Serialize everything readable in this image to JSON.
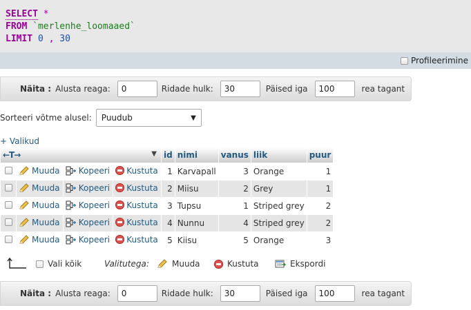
{
  "sql": {
    "select_kw": "SELECT",
    "star": "*",
    "from_kw": "FROM",
    "table": "`merlenhe_loomaaed`",
    "limit_kw": "LIMIT",
    "limit_offset": "0",
    "limit_comma": ",",
    "limit_count": "30"
  },
  "profiling": {
    "label": "Profileerimine",
    "checked": false
  },
  "nav": {
    "show_label": "Näita :",
    "start_label": "Alusta reaga:",
    "start_value": "0",
    "rows_label": "Ridade hulk:",
    "rows_value": "30",
    "headers_label": "Päised iga",
    "headers_value": "100",
    "headers_suffix": "rea tagant"
  },
  "sort": {
    "label": "Sorteeri võtme alusel:",
    "selected": "Puudub"
  },
  "options_link": "+ Valikud",
  "table": {
    "columns": [
      "id",
      "nimi",
      "vanus",
      "liik",
      "puur"
    ],
    "row_actions": {
      "edit": "Muuda",
      "copy": "Kopeeri",
      "delete": "Kustuta"
    },
    "rows": [
      {
        "id": "1",
        "nimi": "Karvapall",
        "vanus": "3",
        "liik": "Orange",
        "puur": "1"
      },
      {
        "id": "2",
        "nimi": "Miisu",
        "vanus": "2",
        "liik": "Grey",
        "puur": "1"
      },
      {
        "id": "3",
        "nimi": "Tupsu",
        "vanus": "1",
        "liik": "Striped grey",
        "puur": "2"
      },
      {
        "id": "4",
        "nimi": "Nunnu",
        "vanus": "4",
        "liik": "Striped grey",
        "puur": "2"
      },
      {
        "id": "5",
        "nimi": "Kiisu",
        "vanus": "5",
        "liik": "Orange",
        "puur": "3"
      }
    ]
  },
  "bulk": {
    "check_all": "Vali kõik",
    "with_selected": "Valitutega:",
    "edit": "Muuda",
    "delete": "Kustuta",
    "export": "Ekspordi"
  },
  "colors": {
    "link": "#235a81",
    "keyword": "#990099",
    "string": "#1c7c1c",
    "number": "#1a4dad",
    "delete": "#d9534f"
  }
}
